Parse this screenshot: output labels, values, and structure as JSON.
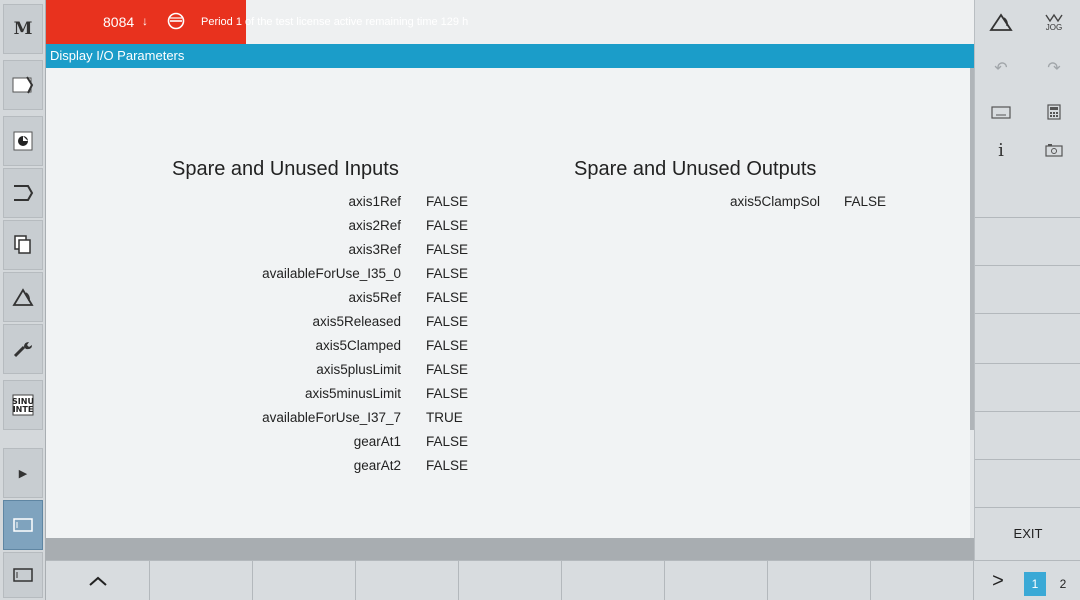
{
  "alarm": {
    "number": "8084",
    "arrow": "↓",
    "message": "Period 1 of the test license active remaining time 129 h",
    "color": "#e8321e"
  },
  "title": "Display I/O Parameters",
  "inputs": {
    "heading": "Spare and Unused Inputs",
    "rows": [
      {
        "name": "axis1Ref",
        "value": "FALSE"
      },
      {
        "name": "axis2Ref",
        "value": "FALSE"
      },
      {
        "name": "axis3Ref",
        "value": "FALSE"
      },
      {
        "name": "availableForUse_I35_0",
        "value": "FALSE"
      },
      {
        "name": "axis5Ref",
        "value": "FALSE"
      },
      {
        "name": "axis5Released",
        "value": "FALSE"
      },
      {
        "name": "axis5Clamped",
        "value": "FALSE"
      },
      {
        "name": "axis5plusLimit",
        "value": "FALSE"
      },
      {
        "name": "axis5minusLimit",
        "value": "FALSE"
      },
      {
        "name": "availableForUse_I37_7",
        "value": "TRUE"
      },
      {
        "name": "gearAt1",
        "value": "FALSE"
      },
      {
        "name": "gearAt2",
        "value": "FALSE"
      }
    ]
  },
  "outputs": {
    "heading": "Spare and Unused Outputs",
    "rows": [
      {
        "name": "axis5ClampSol",
        "value": "FALSE"
      }
    ]
  },
  "right_panel": {
    "jog_label": "JOG",
    "info_label": "i",
    "exit_label": "EXIT"
  },
  "bottom_bar": {
    "next_label": ">",
    "pages": [
      "1",
      "2"
    ]
  },
  "colors": {
    "title_bar": "#1b9dc9",
    "active_page": "#3aa9d6"
  }
}
